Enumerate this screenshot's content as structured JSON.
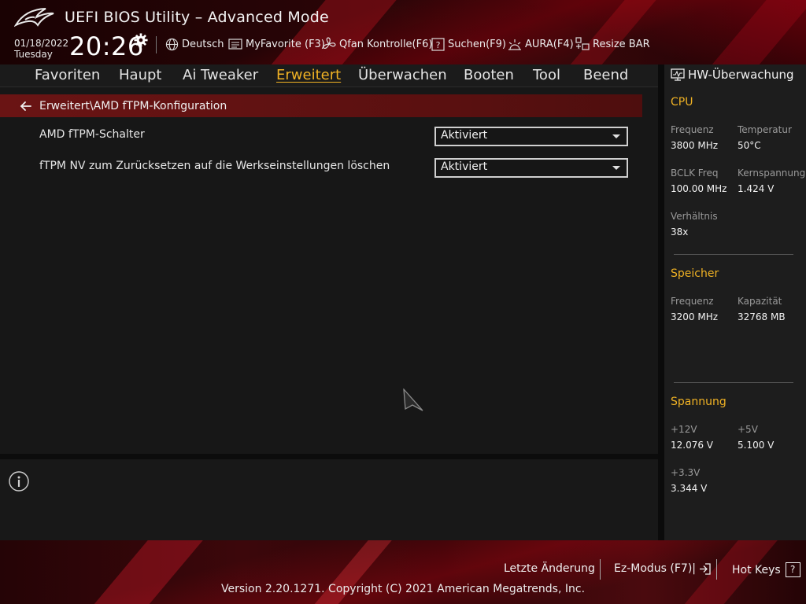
{
  "window": {
    "title": "UEFI BIOS Utility – Advanced Mode"
  },
  "clock": {
    "date": "01/18/2022",
    "day": "Tuesday",
    "time": "20:26"
  },
  "toolbar": [
    {
      "label": "Deutsch",
      "icon": "globe-icon"
    },
    {
      "label": "MyFavorite (F3)",
      "icon": "favorite-list-icon"
    },
    {
      "label": "Qfan Kontrolle(F6)",
      "icon": "fan-icon"
    },
    {
      "label": "Suchen(F9)",
      "icon": "search-help-icon"
    },
    {
      "label": "AURA(F4)",
      "icon": "aura-light-icon"
    },
    {
      "label": "Resize BAR",
      "icon": "resize-bar-icon"
    }
  ],
  "nav": {
    "tabs": [
      {
        "label": "Favoriten"
      },
      {
        "label": "Haupt"
      },
      {
        "label": "Ai Tweaker"
      },
      {
        "label": "Erweitert"
      },
      {
        "label": "Überwachen"
      },
      {
        "label": "Booten"
      },
      {
        "label": "Tool"
      },
      {
        "label": "Beend"
      }
    ],
    "active": "Erweitert"
  },
  "main": {
    "breadcrumb": "Erweitert\\AMD fTPM-Konfiguration",
    "settings": [
      {
        "label": "AMD fTPM-Schalter",
        "value": "Aktiviert"
      },
      {
        "label": "fTPM NV zum Zurücksetzen auf die Werkseinstellungen löschen",
        "value": "Aktiviert"
      }
    ]
  },
  "hw": {
    "title": "HW-Überwachung",
    "cpu": {
      "heading": "CPU",
      "freq_label": "Frequenz",
      "freq": "3800 MHz",
      "temp_label": "Temperatur",
      "temp": "50°C",
      "bclk_label": "BCLK Freq",
      "bclk": "100.00 MHz",
      "vcore_label": "Kernspannung",
      "vcore": "1.424 V",
      "ratio_label": "Verhältnis",
      "ratio": "38x"
    },
    "memory": {
      "heading": "Speicher",
      "freq_label": "Frequenz",
      "freq": "3200 MHz",
      "cap_label": "Kapazität",
      "cap": "32768 MB"
    },
    "voltage": {
      "heading": "Spannung",
      "v12_label": "+12V",
      "v12": "12.076 V",
      "v5_label": "+5V",
      "v5": "5.100 V",
      "v33_label": "+3.3V",
      "v33": "3.344 V"
    }
  },
  "footer": {
    "last_change": "Letzte Änderung",
    "ez_mode": "Ez-Modus (F7)|",
    "hot_keys": "Hot Keys",
    "hot_keys_key": "?",
    "copyright": "Version 2.20.1271. Copyright (C) 2021 American Megatrends, Inc."
  },
  "colors": {
    "accent": "#f0b224",
    "breadcrumb": "#6a1414",
    "header_red": "#3a080b"
  }
}
